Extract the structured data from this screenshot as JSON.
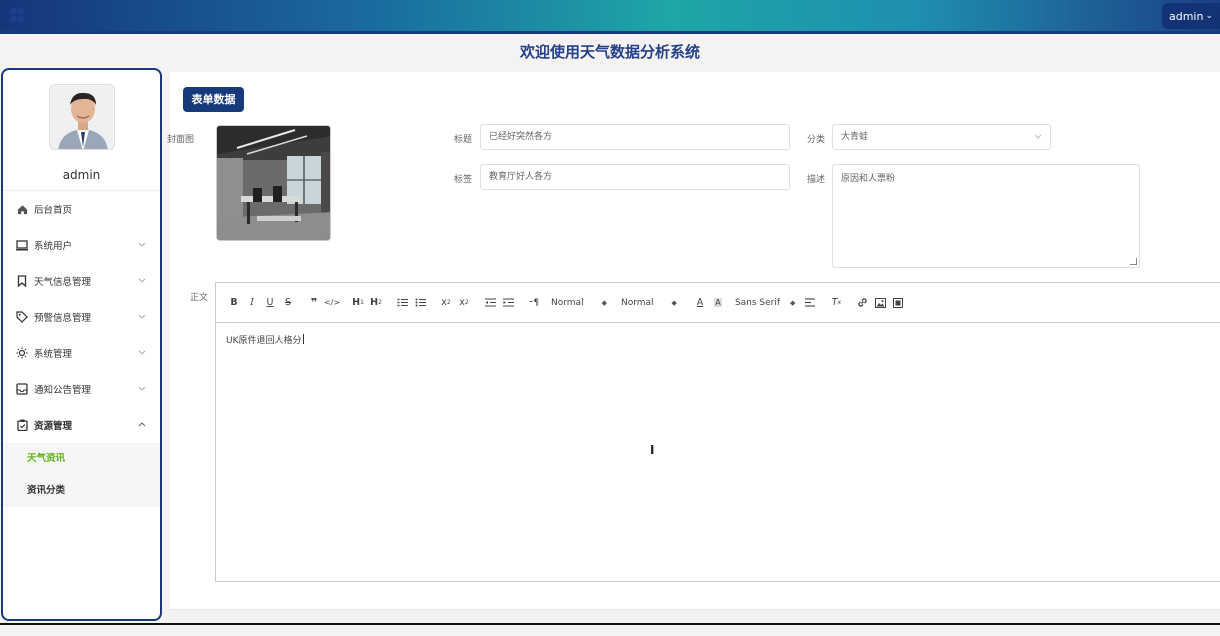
{
  "header": {
    "user_label": "admin",
    "user_chevron": "⌄",
    "page_title": "欢迎使用天气数据分析系统"
  },
  "sidebar": {
    "username": "admin",
    "items": [
      {
        "label": "后台首页",
        "icon": "home-icon"
      },
      {
        "label": "系统用户",
        "icon": "monitor-icon"
      },
      {
        "label": "天气信息管理",
        "icon": "bookmark-icon"
      },
      {
        "label": "预警信息管理",
        "icon": "tag-icon"
      },
      {
        "label": "系统管理",
        "icon": "sun-icon"
      },
      {
        "label": "通知公告管理",
        "icon": "inbox-icon"
      },
      {
        "label": "资源管理",
        "icon": "clipboard-icon"
      }
    ],
    "subitems": [
      {
        "label": "天气资讯",
        "active": true
      },
      {
        "label": "资讯分类",
        "active": false
      }
    ],
    "active_color": "#5fb31e"
  },
  "form": {
    "badge": "表单数据",
    "cover_label": "封面图",
    "title_label": "标题",
    "title_value": "已经好突然各方",
    "category_label": "分类",
    "category_value": "大青蛙",
    "tags_label": "标签",
    "tags_value": "教育厅好人各方",
    "desc_label": "描述",
    "desc_value": "\u001f原因和人票粉",
    "body_label": "正文"
  },
  "editor": {
    "header_select_1": "Normal",
    "header_select_2": "Normal",
    "font_select": "Sans Serif",
    "content": "UK原件退回人格分"
  },
  "colors": {
    "brand": "#173a7c",
    "title": "#24418a"
  }
}
